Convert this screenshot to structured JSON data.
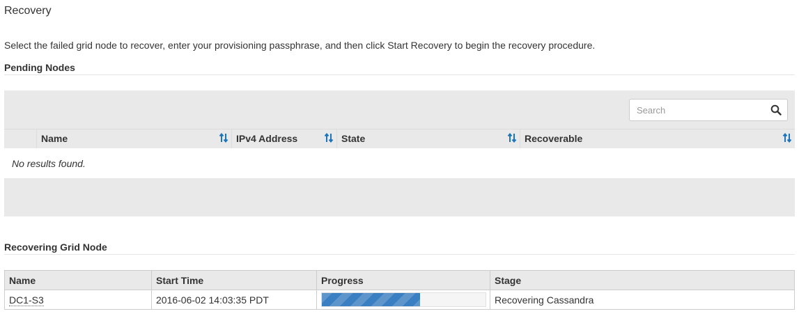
{
  "page": {
    "title": "Recovery",
    "intro": "Select the failed grid node to recover, enter your provisioning passphrase, and then click Start Recovery to begin the recovery procedure."
  },
  "pending": {
    "heading": "Pending Nodes",
    "search_placeholder": "Search",
    "columns": [
      "Name",
      "IPv4 Address",
      "State",
      "Recoverable"
    ],
    "empty_message": "No results found."
  },
  "recovering": {
    "heading": "Recovering Grid Node",
    "columns": [
      "Name",
      "Start Time",
      "Progress",
      "Stage"
    ],
    "row": {
      "name": "DC1-S3",
      "start_time": "2016-06-02 14:03:35 PDT",
      "progress_fraction": 0.6,
      "stage": "Recovering Cassandra"
    }
  },
  "colors": {
    "accent": "#1a75bc",
    "progress": "#3a7fc1",
    "panel_bg": "#e9e9e9"
  },
  "icons": {
    "search": "search-icon",
    "sort": "sort-icon"
  }
}
